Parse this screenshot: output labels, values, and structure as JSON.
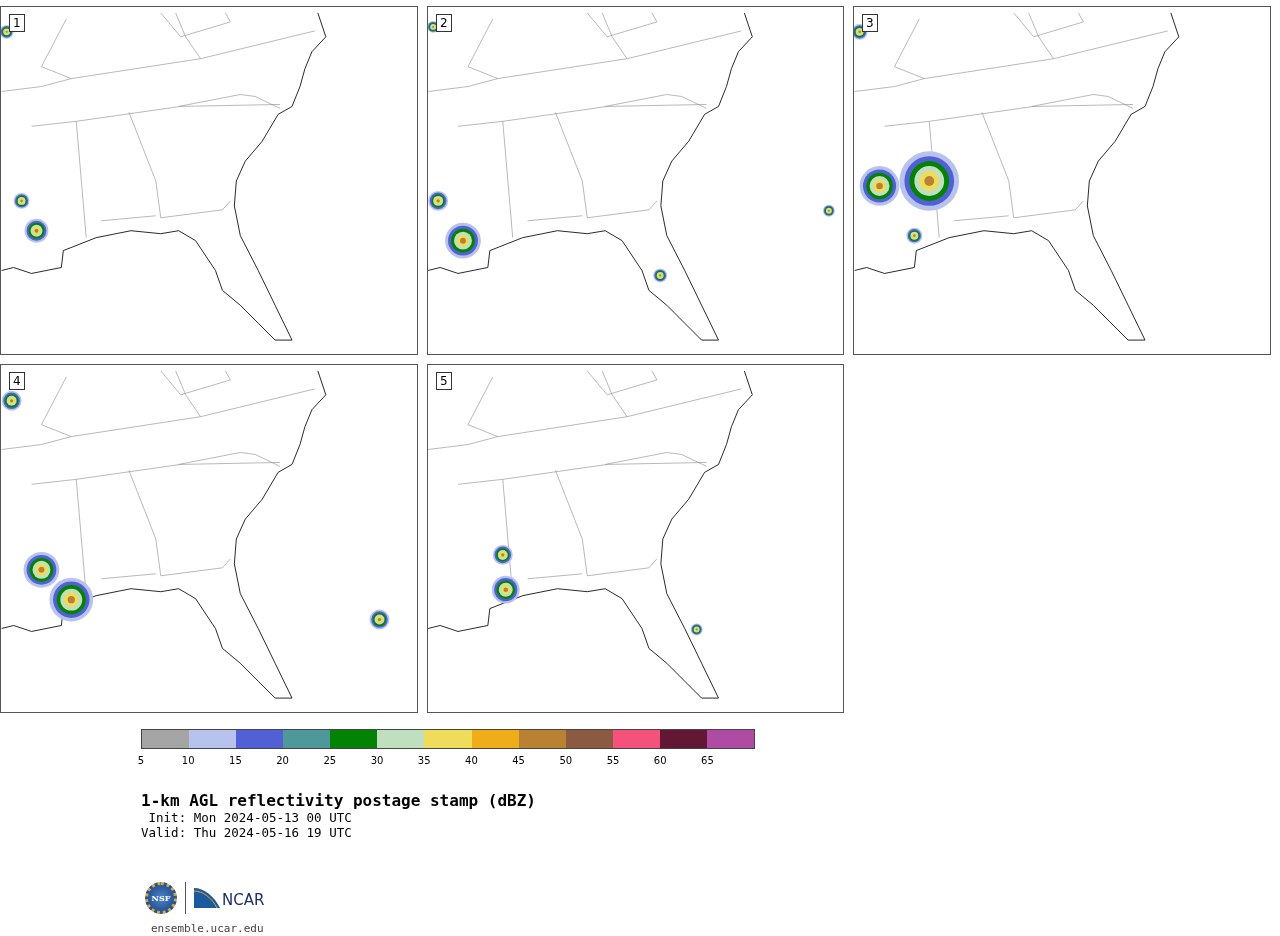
{
  "panels": [
    {
      "label": "1"
    },
    {
      "label": "2"
    },
    {
      "label": "3"
    },
    {
      "label": "4"
    },
    {
      "label": "5"
    }
  ],
  "colorbar": {
    "segments": [
      {
        "color": "#a5a5a5"
      },
      {
        "color": "#b7c3ec"
      },
      {
        "color": "#5160d5"
      },
      {
        "color": "#4f9899"
      },
      {
        "color": "#048203"
      },
      {
        "color": "#bfdfbf"
      },
      {
        "color": "#f0dc5b"
      },
      {
        "color": "#efad19"
      },
      {
        "color": "#b98232"
      },
      {
        "color": "#8a5b40"
      },
      {
        "color": "#f4527a"
      },
      {
        "color": "#621735"
      },
      {
        "color": "#ae4ba3"
      }
    ],
    "ticks": [
      "5",
      "10",
      "15",
      "20",
      "25",
      "30",
      "35",
      "40",
      "45",
      "50",
      "55",
      "60",
      "65"
    ]
  },
  "title": "1-km AGL reflectivity postage stamp (dBZ)",
  "init": " Init: Mon 2024-05-13 00 UTC",
  "valid": "Valid: Thu 2024-05-16 19 UTC",
  "logos": {
    "left": "NSF",
    "right": "NCAR"
  },
  "url": "ensemble.ucar.edu"
}
